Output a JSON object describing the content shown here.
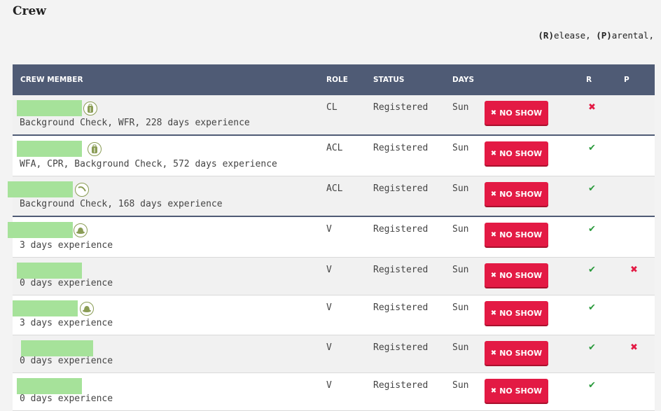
{
  "page": {
    "title": "Crew"
  },
  "legend": {
    "r": "(R)",
    "r_rest": "elease, ",
    "p": "(P)",
    "p_rest": "arental,"
  },
  "table": {
    "headers": {
      "member": "CREW MEMBER",
      "role": "ROLE",
      "status": "STATUS",
      "days": "DAYS",
      "r": "R",
      "p": "P"
    },
    "noshow_label": "NO SHOW",
    "rows": [
      {
        "role": "CL",
        "status": "Registered",
        "days": "Sun",
        "sub": "Background Check, WFR, 228 days experience",
        "icon": "backpack-icon",
        "r": "✖",
        "p": ""
      },
      {
        "role": "ACL",
        "status": "Registered",
        "days": "Sun",
        "sub": "WFA, CPR, Background Check, 572 days experience",
        "icon": "backpack-icon",
        "r": "✔",
        "p": ""
      },
      {
        "role": "ACL",
        "status": "Registered",
        "days": "Sun",
        "sub": "Background Check, 168 days experience",
        "icon": "rope-icon",
        "r": "✔",
        "p": ""
      },
      {
        "role": "V",
        "status": "Registered",
        "days": "Sun",
        "sub": "3 days experience",
        "icon": "hat-icon",
        "r": "✔",
        "p": ""
      },
      {
        "role": "V",
        "status": "Registered",
        "days": "Sun",
        "sub": "0 days experience",
        "icon": "",
        "r": "✔",
        "p": "✖"
      },
      {
        "role": "V",
        "status": "Registered",
        "days": "Sun",
        "sub": "3 days experience",
        "icon": "hat-icon",
        "r": "✔",
        "p": ""
      },
      {
        "role": "V",
        "status": "Registered",
        "days": "Sun",
        "sub": "0 days experience",
        "icon": "",
        "r": "✔",
        "p": "✖"
      },
      {
        "role": "V",
        "status": "Registered",
        "days": "Sun",
        "sub": "0 days experience",
        "icon": "",
        "r": "✔",
        "p": ""
      }
    ]
  }
}
